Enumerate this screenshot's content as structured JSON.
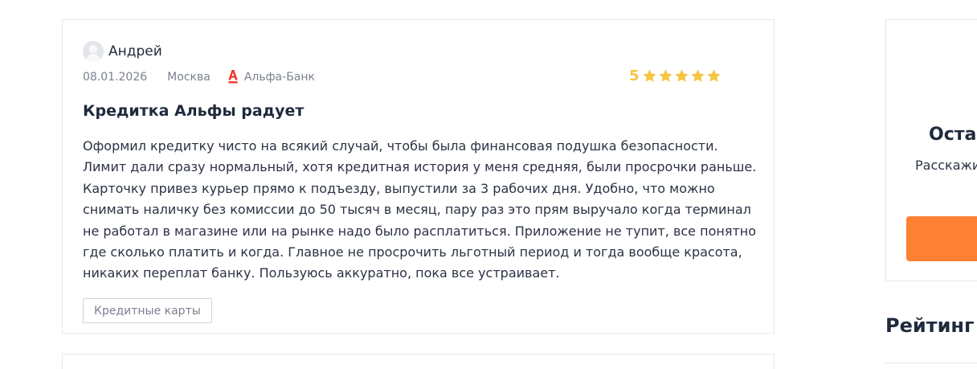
{
  "review": {
    "author": "Андрей",
    "date": "08.01.2026",
    "city": "Москва",
    "bank": {
      "name": "Альфа-Банк",
      "icon": "alfa-bank-logo-icon",
      "color": "#ef3124"
    },
    "rating": {
      "value": "5",
      "stars": 5,
      "max": 5,
      "color": "#f6c543"
    },
    "title": "Кредитка Альфы радует",
    "text": "Оформил кредитку чисто на всякий случай, чтобы была финансовая подушка безопасности. Лимит дали сразу нормальный, хотя кредитная история у меня средняя, были просрочки раньше. Карточку привез курьер прямо к подъезду, выпустили за 3 рабочих дня. Удобно, что можно снимать наличку без комиссии до 50 тысяч в месяц, пару раз это прям выручало когда терминал не работал в магазине или на рынке надо было расплатиться. Приложение не тупит, все понятно где сколько платить и когда. Главное не просрочить льготный период и тогда вообще красота, никаких переплат банку. Пользуюсь аккуратно, пока все устраивает.",
    "tag": "Кредитные карты"
  },
  "sidebar": {
    "title": "Оста",
    "text": "Расскажи",
    "button_color": "#ff8133",
    "rating_heading": "Рейтинг"
  }
}
